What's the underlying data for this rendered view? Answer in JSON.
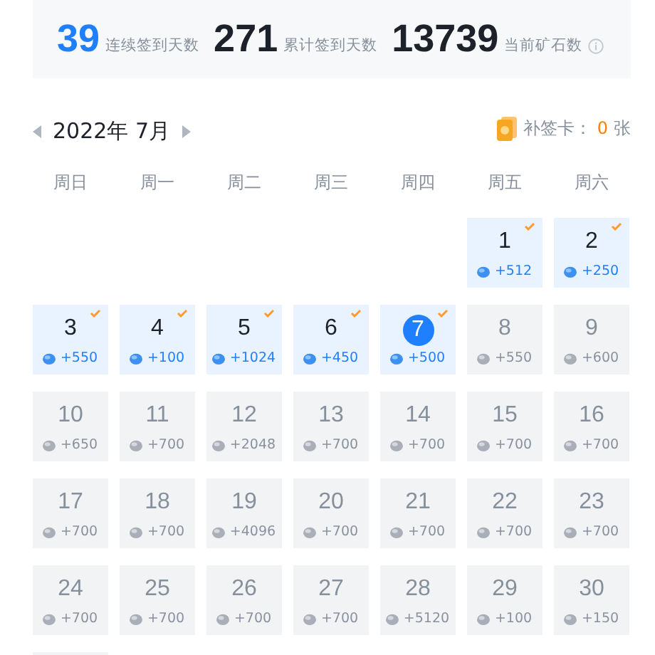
{
  "stats": [
    {
      "count": "39",
      "caption": "连续签到天数",
      "accent": true
    },
    {
      "count": "271",
      "caption": "累计签到天数",
      "accent": false
    },
    {
      "count": "13739",
      "caption": "当前矿石数",
      "accent": false,
      "info": true
    }
  ],
  "calendar": {
    "month": "2022年 7月",
    "makeup_label": "补签卡：",
    "makeup_count": "0",
    "makeup_unit": "张",
    "weekdays": [
      "周日",
      "周一",
      "周二",
      "周三",
      "周四",
      "周五",
      "周六"
    ],
    "days": [
      {
        "day": "1",
        "reward": "+512",
        "signed": true,
        "today": false
      },
      {
        "day": "2",
        "reward": "+250",
        "signed": true,
        "today": false
      },
      {
        "day": "3",
        "reward": "+550",
        "signed": true,
        "today": false
      },
      {
        "day": "4",
        "reward": "+100",
        "signed": true,
        "today": false
      },
      {
        "day": "5",
        "reward": "+1024",
        "signed": true,
        "today": false
      },
      {
        "day": "6",
        "reward": "+450",
        "signed": true,
        "today": false
      },
      {
        "day": "7",
        "reward": "+500",
        "signed": true,
        "today": true
      },
      {
        "day": "8",
        "reward": "+550",
        "signed": false,
        "today": false
      },
      {
        "day": "9",
        "reward": "+600",
        "signed": false,
        "today": false
      },
      {
        "day": "10",
        "reward": "+650",
        "signed": false,
        "today": false
      },
      {
        "day": "11",
        "reward": "+700",
        "signed": false,
        "today": false
      },
      {
        "day": "12",
        "reward": "+2048",
        "signed": false,
        "today": false
      },
      {
        "day": "13",
        "reward": "+700",
        "signed": false,
        "today": false
      },
      {
        "day": "14",
        "reward": "+700",
        "signed": false,
        "today": false
      },
      {
        "day": "15",
        "reward": "+700",
        "signed": false,
        "today": false
      },
      {
        "day": "16",
        "reward": "+700",
        "signed": false,
        "today": false
      },
      {
        "day": "17",
        "reward": "+700",
        "signed": false,
        "today": false
      },
      {
        "day": "18",
        "reward": "+700",
        "signed": false,
        "today": false
      },
      {
        "day": "19",
        "reward": "+4096",
        "signed": false,
        "today": false
      },
      {
        "day": "20",
        "reward": "+700",
        "signed": false,
        "today": false
      },
      {
        "day": "21",
        "reward": "+700",
        "signed": false,
        "today": false
      },
      {
        "day": "22",
        "reward": "+700",
        "signed": false,
        "today": false
      },
      {
        "day": "23",
        "reward": "+700",
        "signed": false,
        "today": false
      },
      {
        "day": "24",
        "reward": "+700",
        "signed": false,
        "today": false
      },
      {
        "day": "25",
        "reward": "+700",
        "signed": false,
        "today": false
      },
      {
        "day": "26",
        "reward": "+700",
        "signed": false,
        "today": false
      },
      {
        "day": "27",
        "reward": "+700",
        "signed": false,
        "today": false
      },
      {
        "day": "28",
        "reward": "+5120",
        "signed": false,
        "today": false
      },
      {
        "day": "29",
        "reward": "+100",
        "signed": false,
        "today": false
      },
      {
        "day": "30",
        "reward": "+150",
        "signed": false,
        "today": false
      }
    ]
  }
}
